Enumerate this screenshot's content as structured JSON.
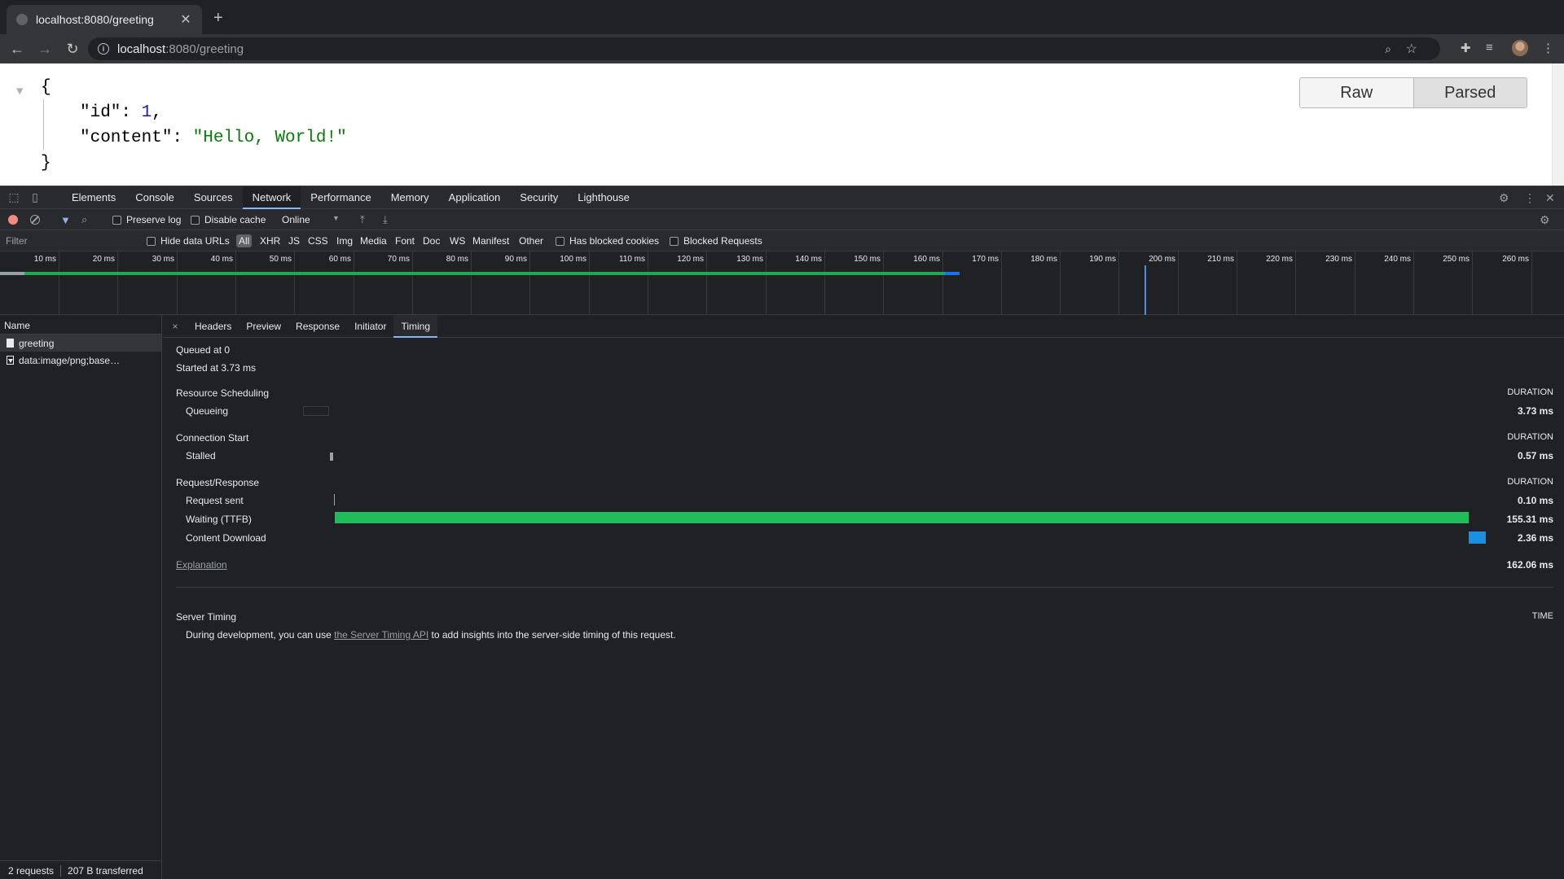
{
  "browser": {
    "tab_title": "localhost:8080/greeting",
    "url_host": "localhost",
    "url_path": ":8080/greeting"
  },
  "page": {
    "json_open": "{",
    "json_close": "}",
    "id_key": "\"id\"",
    "id_value": "1",
    "content_key": "\"content\"",
    "content_value": "\"Hello, World!\"",
    "raw_label": "Raw",
    "parsed_label": "Parsed"
  },
  "devtools": {
    "tabs": [
      "Elements",
      "Console",
      "Sources",
      "Network",
      "Performance",
      "Memory",
      "Application",
      "Security",
      "Lighthouse"
    ],
    "active_tab": "Network",
    "preserve_log": "Preserve log",
    "disable_cache": "Disable cache",
    "throttle": "Online",
    "filter_placeholder": "Filter",
    "hide_data_urls": "Hide data URLs",
    "types": [
      "All",
      "XHR",
      "JS",
      "CSS",
      "Img",
      "Media",
      "Font",
      "Doc",
      "WS",
      "Manifest",
      "Other"
    ],
    "has_blocked_cookies": "Has blocked cookies",
    "blocked_requests": "Blocked Requests",
    "ticks": [
      "10 ms",
      "20 ms",
      "30 ms",
      "40 ms",
      "50 ms",
      "60 ms",
      "70 ms",
      "80 ms",
      "90 ms",
      "100 ms",
      "110 ms",
      "120 ms",
      "130 ms",
      "140 ms",
      "150 ms",
      "160 ms",
      "170 ms",
      "180 ms",
      "190 ms",
      "200 ms",
      "210 ms",
      "220 ms",
      "230 ms",
      "240 ms",
      "250 ms",
      "260 ms"
    ],
    "list_header": "Name",
    "requests": [
      "greeting",
      "data:image/png;base…"
    ],
    "summary_requests": "2 requests",
    "summary_transferred": "207 B transferred",
    "detail_tabs": [
      "Headers",
      "Preview",
      "Response",
      "Initiator",
      "Timing"
    ],
    "active_detail_tab": "Timing"
  },
  "timing": {
    "queued_at": "Queued at 0",
    "started_at": "Started at 3.73 ms",
    "duration_label": "DURATION",
    "resource_scheduling": "Resource Scheduling",
    "queueing": "Queueing",
    "queueing_value": "3.73 ms",
    "connection_start": "Connection Start",
    "stalled": "Stalled",
    "stalled_value": "0.57 ms",
    "request_response": "Request/Response",
    "request_sent": "Request sent",
    "request_sent_value": "0.10 ms",
    "waiting": "Waiting (TTFB)",
    "waiting_value": "155.31 ms",
    "content_download": "Content Download",
    "content_download_value": "2.36 ms",
    "explanation": "Explanation",
    "total": "162.06 ms",
    "server_timing": "Server Timing",
    "time_label": "TIME",
    "server_text_before": "During development, you can use ",
    "server_link": "the Server Timing API",
    "server_text_after": " to add insights into the server-side timing of this request.",
    "colors": {
      "waiting": "#1fbe5a",
      "download": "#1a8fe3",
      "queueing": "#3c3c3c"
    }
  }
}
